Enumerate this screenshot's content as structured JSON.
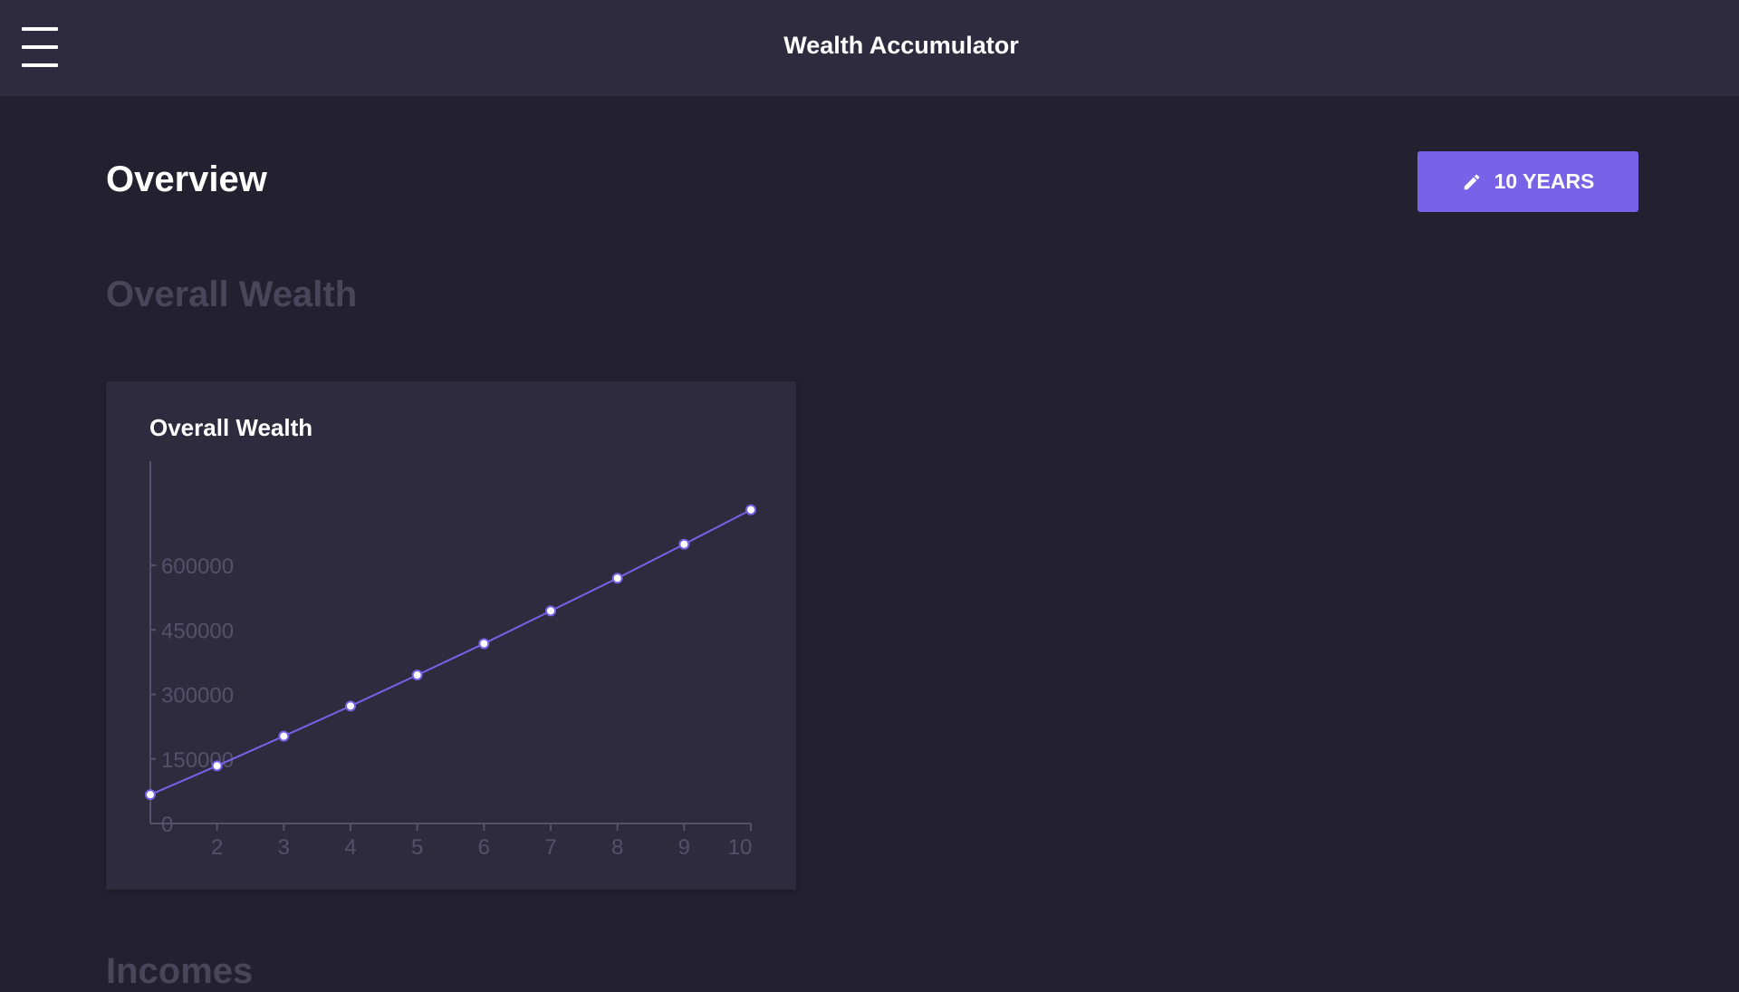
{
  "app": {
    "title": "Wealth Accumulator"
  },
  "header": {
    "menu_icon": "hamburger-menu-icon"
  },
  "page": {
    "title": "Overview",
    "years_button": {
      "icon": "pencil-icon",
      "label": "10 YEARS"
    }
  },
  "sections": {
    "overall_wealth": "Overall Wealth",
    "incomes": "Incomes"
  },
  "colors": {
    "accent": "#7762e8",
    "background": "#23212f",
    "surface": "#2e2b3f",
    "muted_heading": "#4a4659",
    "axis": "#55516a",
    "line": "#7762e8"
  },
  "chart_card": {
    "title": "Overall Wealth"
  },
  "chart_data": {
    "type": "line",
    "title": "Overall Wealth",
    "x": [
      1,
      2,
      3,
      4,
      5,
      6,
      7,
      8,
      9,
      10
    ],
    "values": [
      67000,
      134000,
      203000,
      273000,
      345000,
      418000,
      494000,
      570000,
      649000,
      729000
    ],
    "xticks": [
      2,
      3,
      4,
      5,
      6,
      7,
      8,
      9,
      10
    ],
    "yticks": [
      0,
      150000,
      300000,
      450000,
      600000
    ],
    "xlim": [
      1,
      10
    ],
    "ylim": [
      0,
      800000
    ],
    "grid": false,
    "legend": "none"
  }
}
